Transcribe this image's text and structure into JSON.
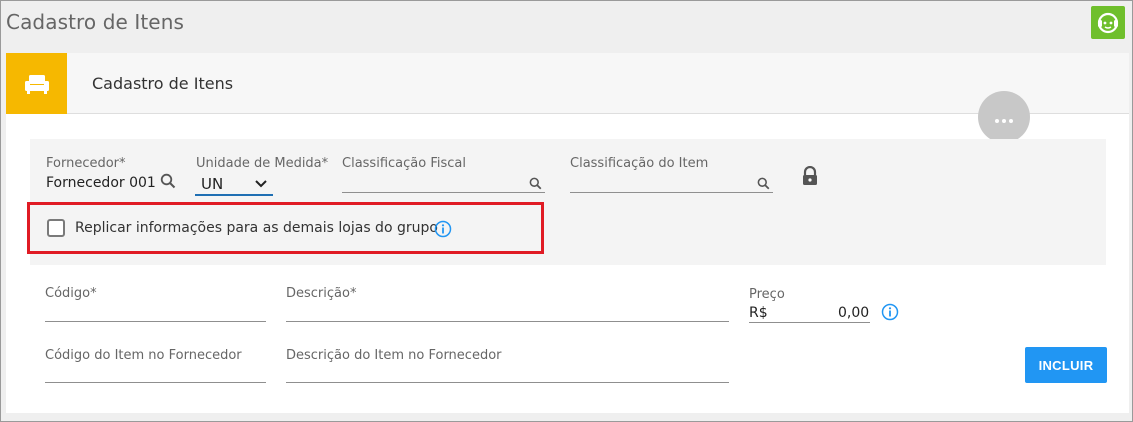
{
  "page": {
    "title": "Cadastro de Itens"
  },
  "header": {
    "card_title": "Cadastro de Itens",
    "icon": "sofa-icon",
    "support_icon": "support-chat-icon",
    "more_icon": "more-horizontal-icon"
  },
  "filters": {
    "fornecedor": {
      "label": "Fornecedor*",
      "value": "Fornecedor 001"
    },
    "unidade": {
      "label": "Unidade de Medida*",
      "value": "UN"
    },
    "classificacao_fiscal": {
      "label": "Classificação Fiscal",
      "value": ""
    },
    "classificacao_item": {
      "label": "Classificação do Item",
      "value": ""
    },
    "replicate": {
      "label": "Replicar informações para as demais lojas do grupo",
      "checked": false
    }
  },
  "form": {
    "codigo": {
      "label": "Código*",
      "value": ""
    },
    "descricao": {
      "label": "Descrição*",
      "value": ""
    },
    "preco": {
      "label": "Preço",
      "currency": "R$",
      "value": "0,00"
    },
    "codigo_fornecedor": {
      "label": "Código do Item no Fornecedor",
      "value": ""
    },
    "descricao_fornecedor": {
      "label": "Descrição do Item no Fornecedor",
      "value": ""
    },
    "include_button": "INCLUIR"
  },
  "colors": {
    "accent": "#2196f3",
    "header_icon_bg": "#f6b800",
    "support_bg": "#6fbf2c",
    "highlight_border": "#e01b24"
  }
}
